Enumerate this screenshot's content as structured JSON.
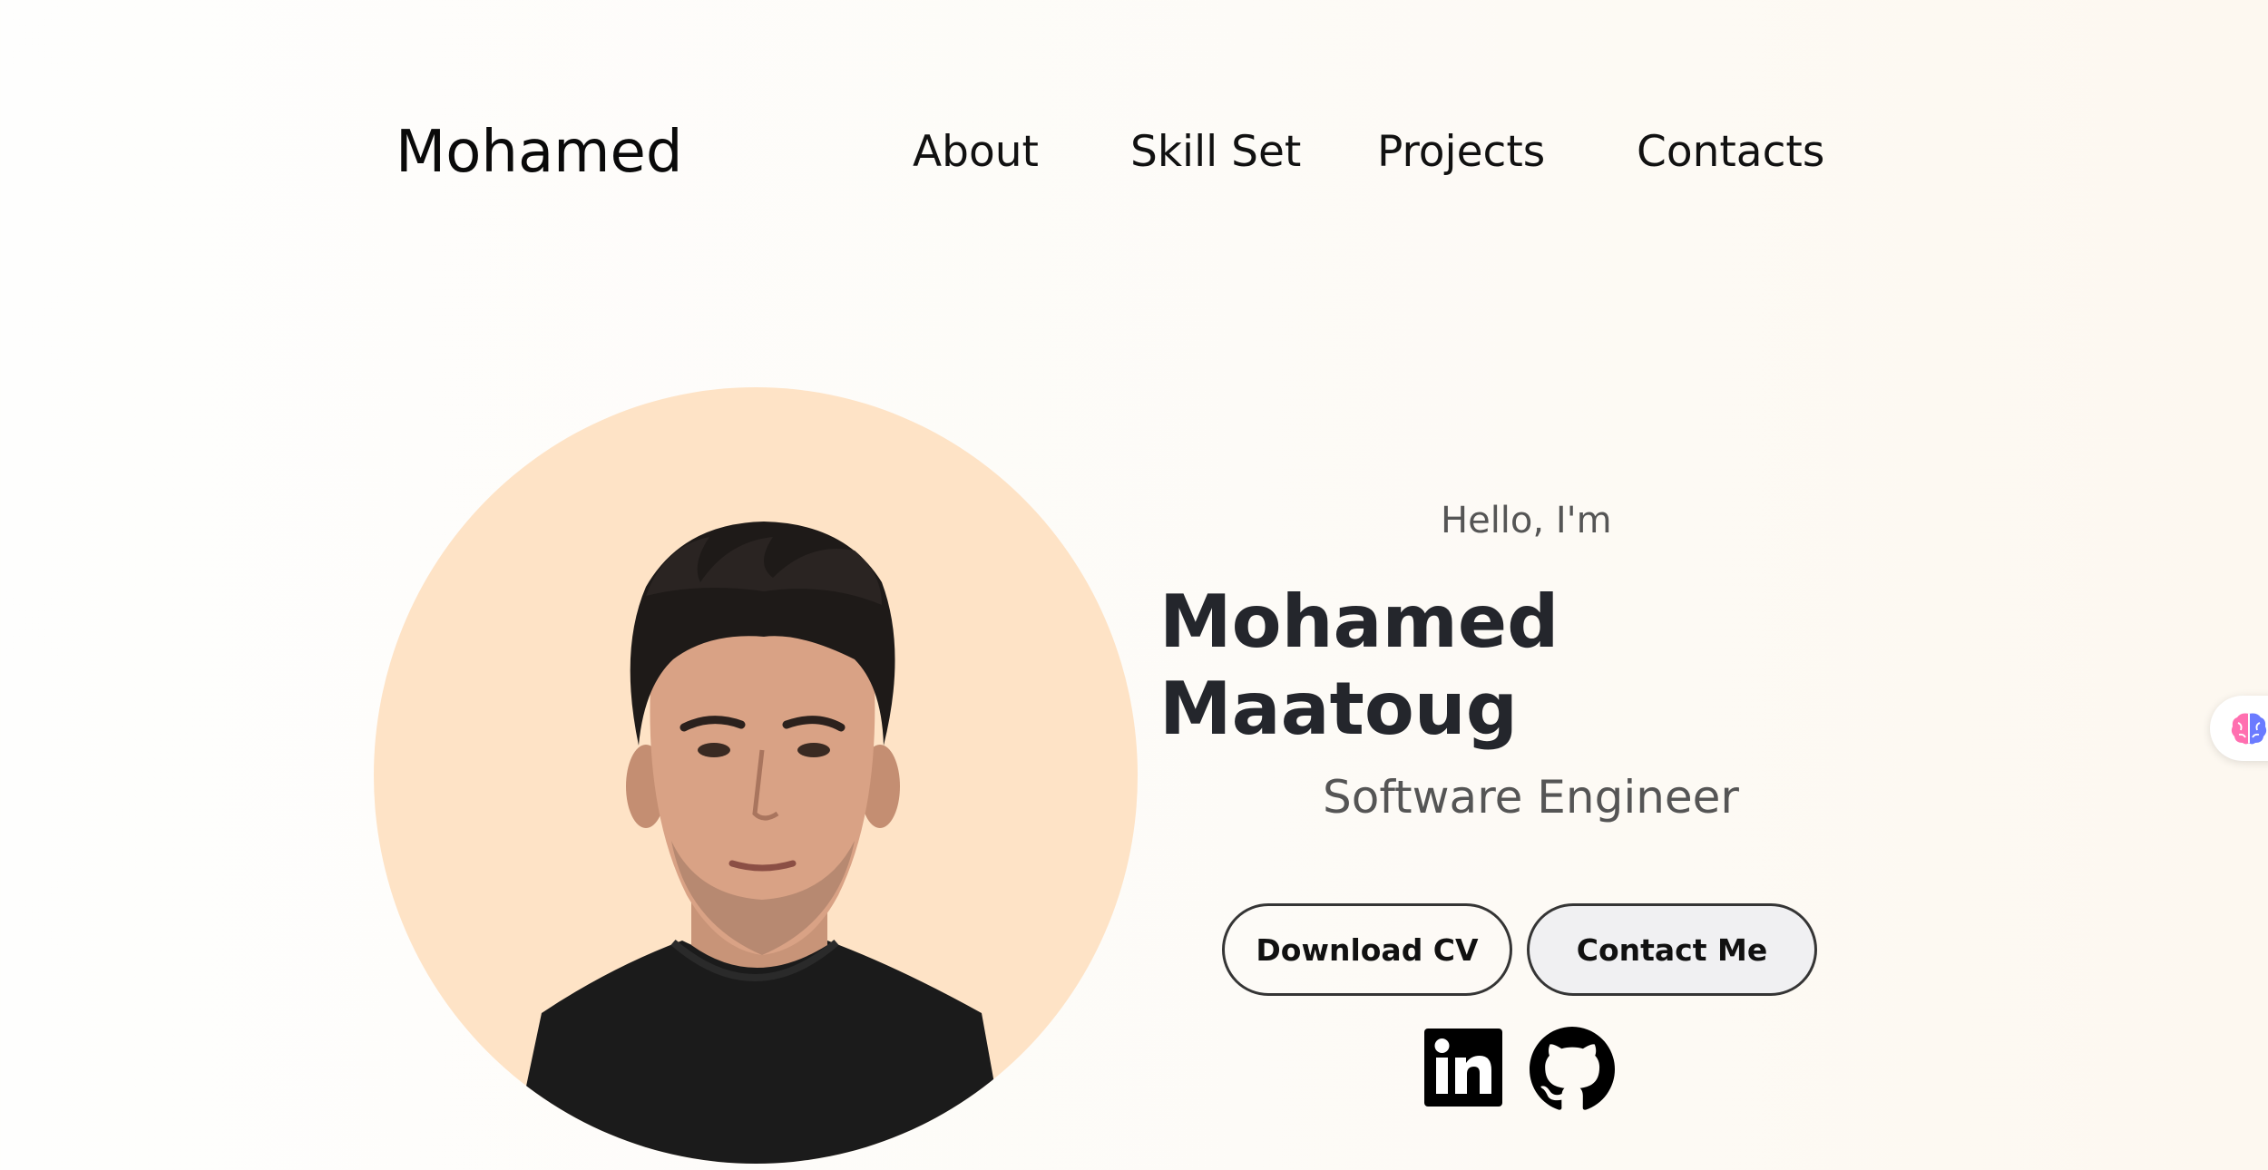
{
  "nav": {
    "logo": "Mohamed",
    "links": [
      "About",
      "Skill Set",
      "Projects",
      "Contacts"
    ]
  },
  "hero": {
    "greeting": "Hello, I'm",
    "name": "Mohamed Maatoug",
    "role": "Software Engineer",
    "buttons": {
      "download_cv": "Download CV",
      "contact_me": "Contact Me"
    },
    "social": [
      "linkedin-icon",
      "github-icon"
    ]
  },
  "widget": {
    "icon": "brain-icon"
  },
  "colors": {
    "circle": "#fee3c6",
    "name_text": "#24262c",
    "contact_button_bg": "#f0f0f2"
  }
}
